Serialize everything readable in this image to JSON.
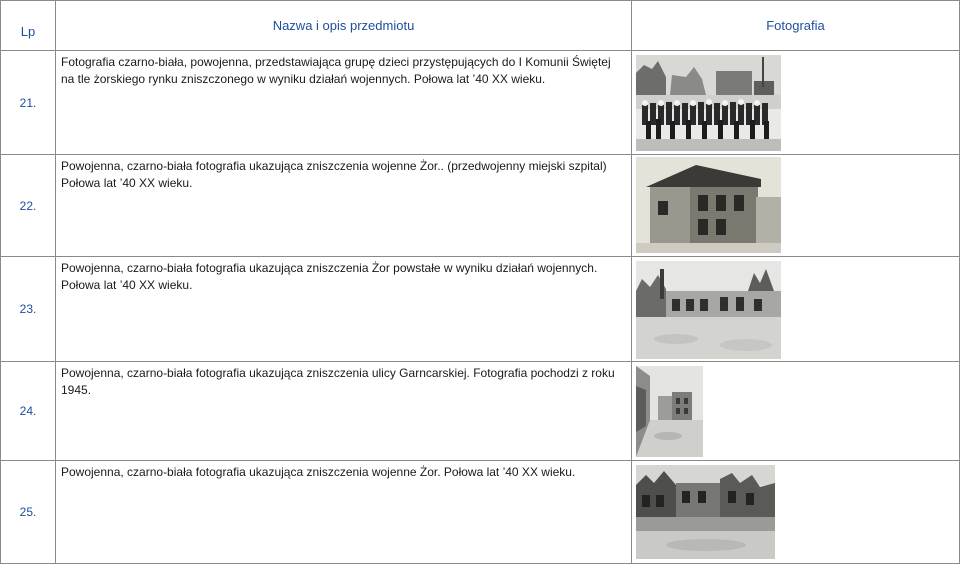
{
  "header": {
    "lp": "Lp",
    "name": "Nazwa i opis przedmiotu",
    "photo": "Fotografia"
  },
  "rows": [
    {
      "lp": "21.",
      "description": "Fotografia czarno-biała, powojenna, przedstawiająca grupę dzieci przystępujących do I Komunii Świętej na tle żorskiego rynku zniszczonego w wyniku działań wojennych. Połowa lat ’40 XX wieku.",
      "photo_subject": "children-first-communion-photo"
    },
    {
      "lp": "22.",
      "description": "Powojenna, czarno-biała fotografia ukazująca zniszczenia wojenne Żor.. (przedwojenny miejski szpital) Połowa lat ’40 XX wieku.",
      "photo_subject": "ruined-hospital-photo"
    },
    {
      "lp": "23.",
      "description": "Powojenna, czarno-biała fotografia ukazująca zniszczenia Żor powstałe w wyniku działań wojennych. Połowa lat ’40 XX wieku.",
      "photo_subject": "ruined-town-square-photo"
    },
    {
      "lp": "24.",
      "description": "Powojenna, czarno-biała fotografia ukazująca zniszczenia ulicy Garncarskiej. Fotografia pochodzi z roku 1945.",
      "photo_subject": "ruined-street-photo"
    },
    {
      "lp": "25.",
      "description": "Powojenna, czarno-biała fotografia ukazująca zniszczenia wojenne Żor. Połowa lat ’40 XX wieku.",
      "photo_subject": "ruined-buildings-photo"
    }
  ],
  "colors": {
    "header_text": "#1f4e9c",
    "border": "#8a8a8a"
  }
}
